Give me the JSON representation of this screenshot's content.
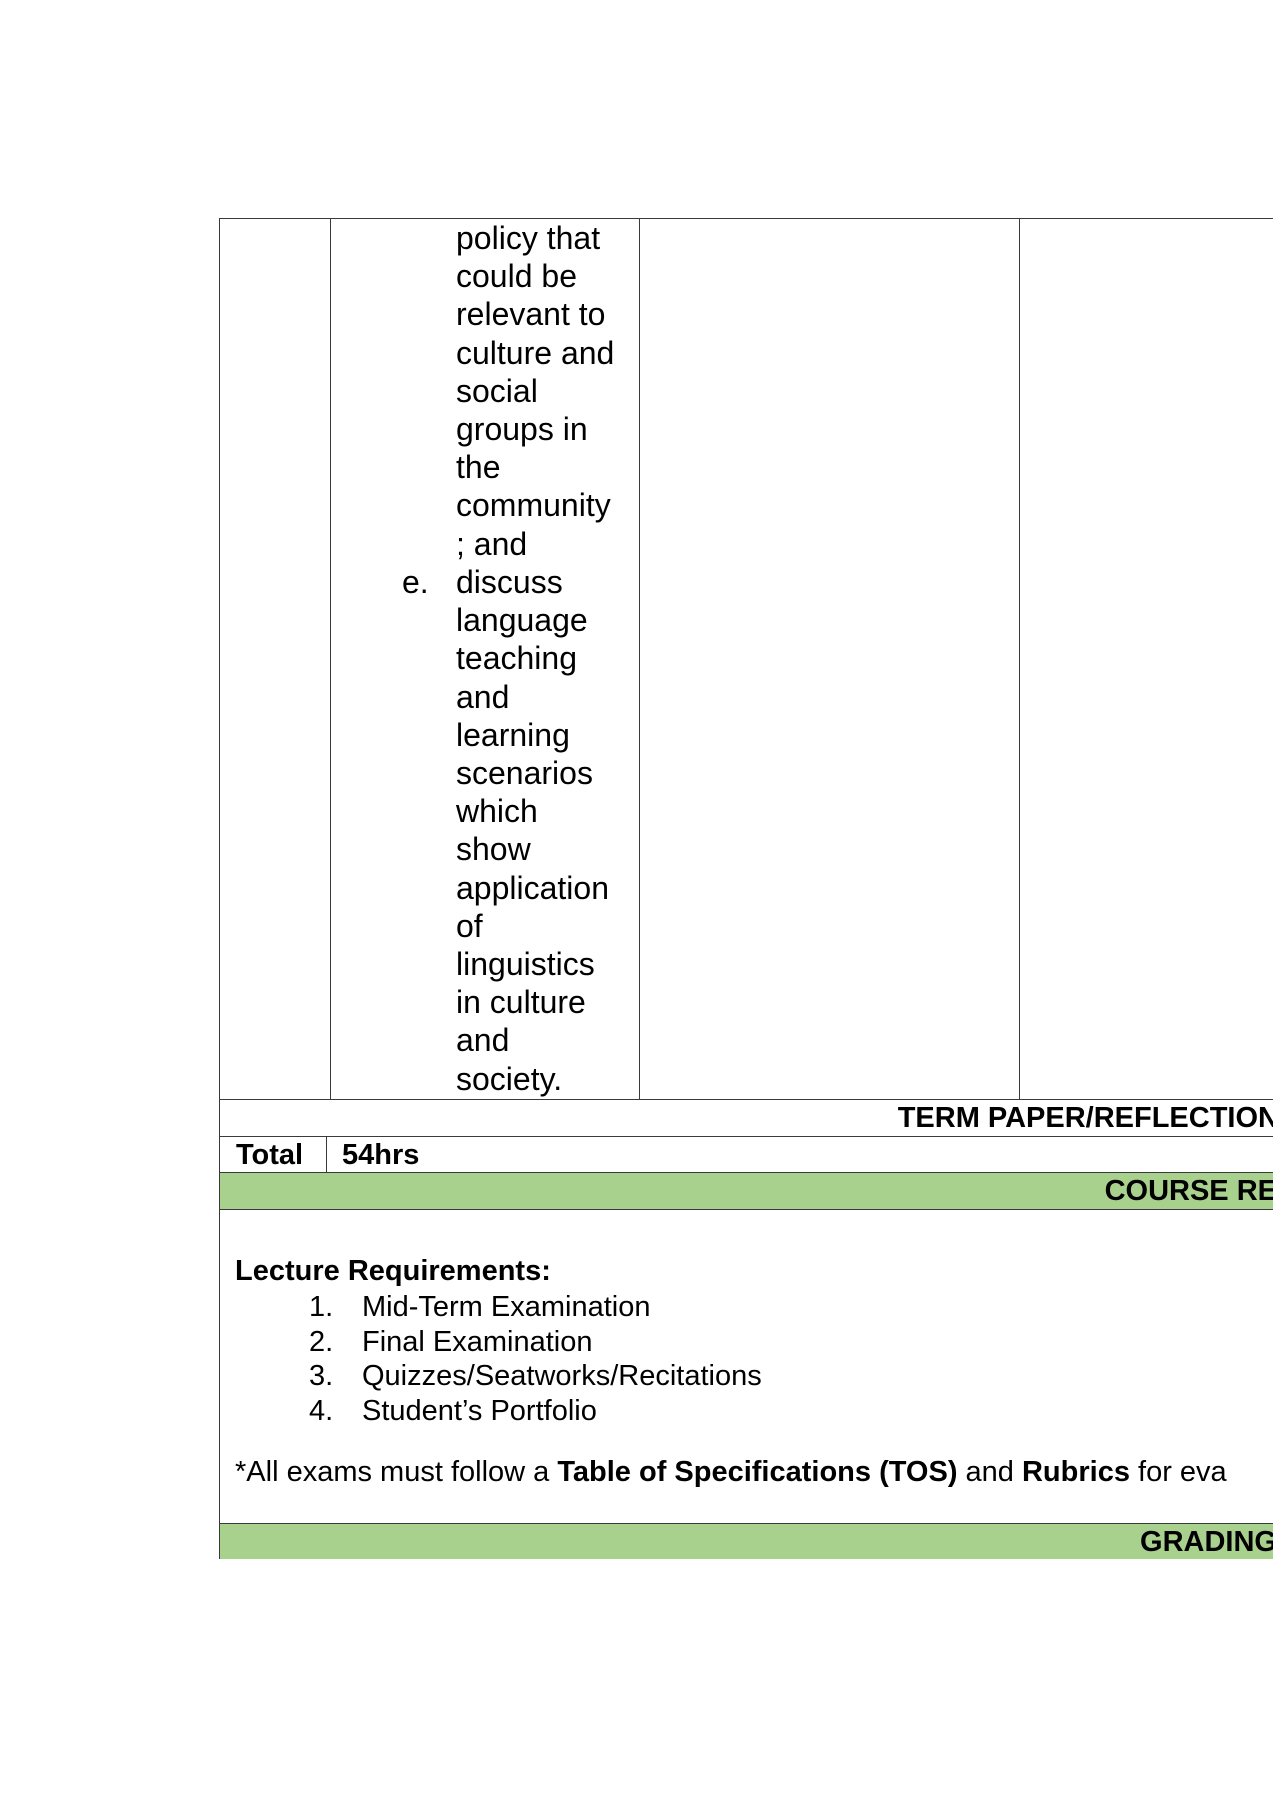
{
  "objective_continuation": [
    "policy that",
    "could be",
    "relevant to",
    "culture and",
    "social",
    "groups in",
    "the",
    "community",
    "; and"
  ],
  "objective_e": {
    "marker": "e.",
    "lines": [
      "discuss",
      "language",
      "teaching",
      "and",
      "learning",
      "scenarios",
      "which",
      "show",
      "application",
      "of",
      "linguistics",
      "in culture",
      "and",
      "society."
    ]
  },
  "term_paper_header": "TERM PAPER/REFLECTION",
  "total": {
    "label": "Total",
    "value": "54hrs"
  },
  "course_requirements_header": "COURSE RE",
  "lecture_requirements": {
    "title": "Lecture Requirements:",
    "items": [
      {
        "num": "1.",
        "text": "Mid-Term Examination"
      },
      {
        "num": "2.",
        "text": "Final Examination"
      },
      {
        "num": "3.",
        "text": "Quizzes/Seatworks/Recitations"
      },
      {
        "num": "4.",
        "text": "Student’s Portfolio"
      }
    ]
  },
  "note": {
    "prefix": "*All exams must follow a ",
    "bold1": "Table of Specifications (TOS)",
    "middle": " and ",
    "bold2": "Rubrics",
    "suffix": " for eva"
  },
  "grading_header": "GRADING",
  "colors": {
    "header_green": "#a9d18e",
    "border": "#3a3a3a"
  }
}
